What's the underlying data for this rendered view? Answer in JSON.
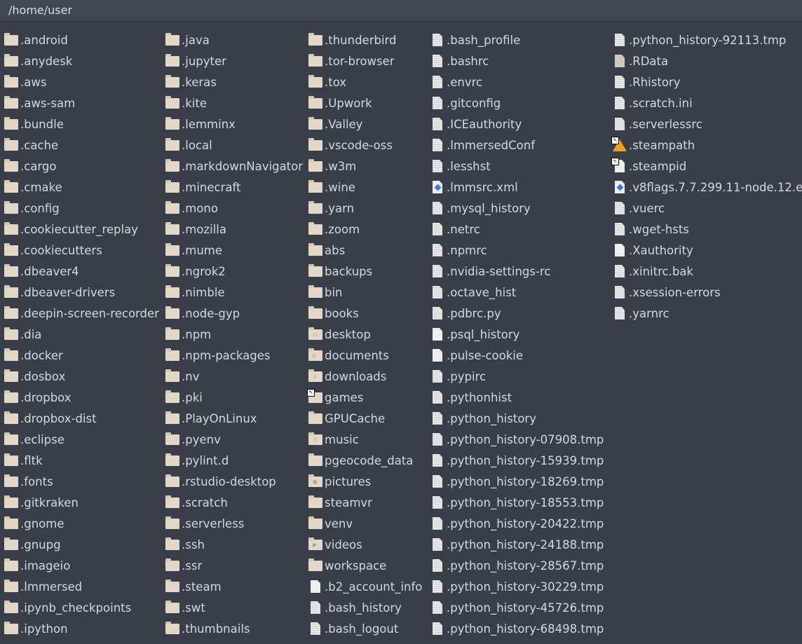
{
  "path": "/home/user",
  "columns": [
    [
      [
        "folder",
        ".android"
      ],
      [
        "folder",
        ".anydesk"
      ],
      [
        "folder",
        ".aws"
      ],
      [
        "folder",
        ".aws-sam"
      ],
      [
        "folder",
        ".bundle"
      ],
      [
        "folder",
        ".cache"
      ],
      [
        "folder",
        ".cargo"
      ],
      [
        "folder",
        ".cmake"
      ],
      [
        "folder",
        ".config"
      ],
      [
        "folder",
        ".cookiecutter_replay"
      ],
      [
        "folder",
        ".cookiecutters"
      ],
      [
        "folder",
        ".dbeaver4"
      ],
      [
        "folder",
        ".dbeaver-drivers"
      ],
      [
        "folder",
        ".deepin-screen-recorder"
      ],
      [
        "folder",
        ".dia"
      ],
      [
        "folder",
        ".docker"
      ],
      [
        "folder",
        ".dosbox"
      ],
      [
        "folder",
        ".dropbox"
      ],
      [
        "folder",
        ".dropbox-dist"
      ],
      [
        "folder",
        ".eclipse"
      ],
      [
        "folder",
        ".fltk"
      ],
      [
        "folder",
        ".fonts"
      ],
      [
        "folder",
        ".gitkraken"
      ],
      [
        "folder",
        ".gnome"
      ],
      [
        "folder",
        ".gnupg"
      ],
      [
        "folder",
        ".imageio"
      ],
      [
        "folder",
        ".lmmersed"
      ],
      [
        "folder",
        ".ipynb_checkpoints"
      ],
      [
        "folder",
        ".ipython"
      ]
    ],
    [
      [
        "folder",
        ".java"
      ],
      [
        "folder",
        ".jupyter"
      ],
      [
        "folder",
        ".keras"
      ],
      [
        "folder",
        ".kite"
      ],
      [
        "folder",
        ".lemminx"
      ],
      [
        "folder",
        ".local"
      ],
      [
        "folder",
        ".markdownNavigator"
      ],
      [
        "folder",
        ".minecraft"
      ],
      [
        "folder",
        ".mono"
      ],
      [
        "folder",
        ".mozilla"
      ],
      [
        "folder",
        ".mume"
      ],
      [
        "folder",
        ".ngrok2"
      ],
      [
        "folder",
        ".nimble"
      ],
      [
        "folder",
        ".node-gyp"
      ],
      [
        "folder",
        ".npm"
      ],
      [
        "folder",
        ".npm-packages"
      ],
      [
        "folder",
        ".nv"
      ],
      [
        "folder",
        ".pki"
      ],
      [
        "folder",
        ".PlayOnLinux"
      ],
      [
        "folder",
        ".pyenv"
      ],
      [
        "folder",
        ".pylint.d"
      ],
      [
        "folder",
        ".rstudio-desktop"
      ],
      [
        "folder",
        ".scratch"
      ],
      [
        "folder",
        ".serverless"
      ],
      [
        "folder",
        ".ssh"
      ],
      [
        "folder",
        ".ssr"
      ],
      [
        "folder",
        ".steam"
      ],
      [
        "folder",
        ".swt"
      ],
      [
        "folder",
        ".thumbnails"
      ]
    ],
    [
      [
        "folder",
        ".thunderbird"
      ],
      [
        "folder",
        ".tor-browser"
      ],
      [
        "folder",
        ".tox"
      ],
      [
        "folder",
        ".Upwork"
      ],
      [
        "folder",
        ".Valley"
      ],
      [
        "folder",
        ".vscode-oss"
      ],
      [
        "folder",
        ".w3m"
      ],
      [
        "folder",
        ".wine"
      ],
      [
        "folder",
        ".yarn"
      ],
      [
        "folder",
        ".zoom"
      ],
      [
        "folder",
        "abs"
      ],
      [
        "folder",
        "backups"
      ],
      [
        "folder",
        "bin"
      ],
      [
        "folder",
        "books"
      ],
      [
        "folder-desktop",
        "desktop"
      ],
      [
        "folder-documents",
        "documents"
      ],
      [
        "folder-downloads",
        "downloads"
      ],
      [
        "folder-link",
        "games"
      ],
      [
        "folder",
        "GPUCache"
      ],
      [
        "folder-music",
        "music"
      ],
      [
        "folder",
        "pgeocode_data"
      ],
      [
        "folder-pictures",
        "pictures"
      ],
      [
        "folder",
        "steamvr"
      ],
      [
        "folder",
        "venv"
      ],
      [
        "folder-videos",
        "videos"
      ],
      [
        "folder",
        "workspace"
      ],
      [
        "file",
        ".b2_account_info"
      ],
      [
        "text",
        ".bash_history"
      ],
      [
        "text",
        ".bash_logout"
      ]
    ],
    [
      [
        "text",
        ".bash_profile"
      ],
      [
        "text",
        ".bashrc"
      ],
      [
        "text",
        ".envrc"
      ],
      [
        "text",
        ".gitconfig"
      ],
      [
        "text",
        ".ICEauthority"
      ],
      [
        "text",
        ".lmmersedConf"
      ],
      [
        "text",
        ".lesshst"
      ],
      [
        "xml",
        ".lmmsrc.xml"
      ],
      [
        "text",
        ".mysql_history"
      ],
      [
        "text",
        ".netrc"
      ],
      [
        "text",
        ".npmrc"
      ],
      [
        "text",
        ".nvidia-settings-rc"
      ],
      [
        "text",
        ".octave_hist"
      ],
      [
        "text",
        ".pdbrc.py"
      ],
      [
        "file",
        ".psql_history"
      ],
      [
        "file",
        ".pulse-cookie"
      ],
      [
        "text",
        ".pypirc"
      ],
      [
        "text",
        ".pythonhist"
      ],
      [
        "text",
        ".python_history"
      ],
      [
        "text",
        ".python_history-07908.tmp"
      ],
      [
        "text",
        ".python_history-15939.tmp"
      ],
      [
        "text",
        ".python_history-18269.tmp"
      ],
      [
        "text",
        ".python_history-18553.tmp"
      ],
      [
        "text",
        ".python_history-20422.tmp"
      ],
      [
        "text",
        ".python_history-24188.tmp"
      ],
      [
        "text",
        ".python_history-28567.tmp"
      ],
      [
        "text",
        ".python_history-30229.tmp"
      ],
      [
        "text",
        ".python_history-45726.tmp"
      ],
      [
        "text",
        ".python_history-68498.tmp"
      ]
    ],
    [
      [
        "text",
        ".python_history-92113.tmp"
      ],
      [
        "rdata",
        ".RData"
      ],
      [
        "text",
        ".Rhistory"
      ],
      [
        "text",
        ".scratch.ini"
      ],
      [
        "text",
        ".serverlessrc"
      ],
      [
        "broken-link",
        ".steampath"
      ],
      [
        "file-link",
        ".steampid"
      ],
      [
        "xml",
        ".v8flags.7.7.299.11-node.12.e"
      ],
      [
        "text",
        ".vuerc"
      ],
      [
        "text",
        ".wget-hsts"
      ],
      [
        "file",
        ".Xauthority"
      ],
      [
        "text",
        ".xinitrc.bak"
      ],
      [
        "text",
        ".xsession-errors"
      ],
      [
        "text",
        ".yarnrc"
      ]
    ]
  ]
}
